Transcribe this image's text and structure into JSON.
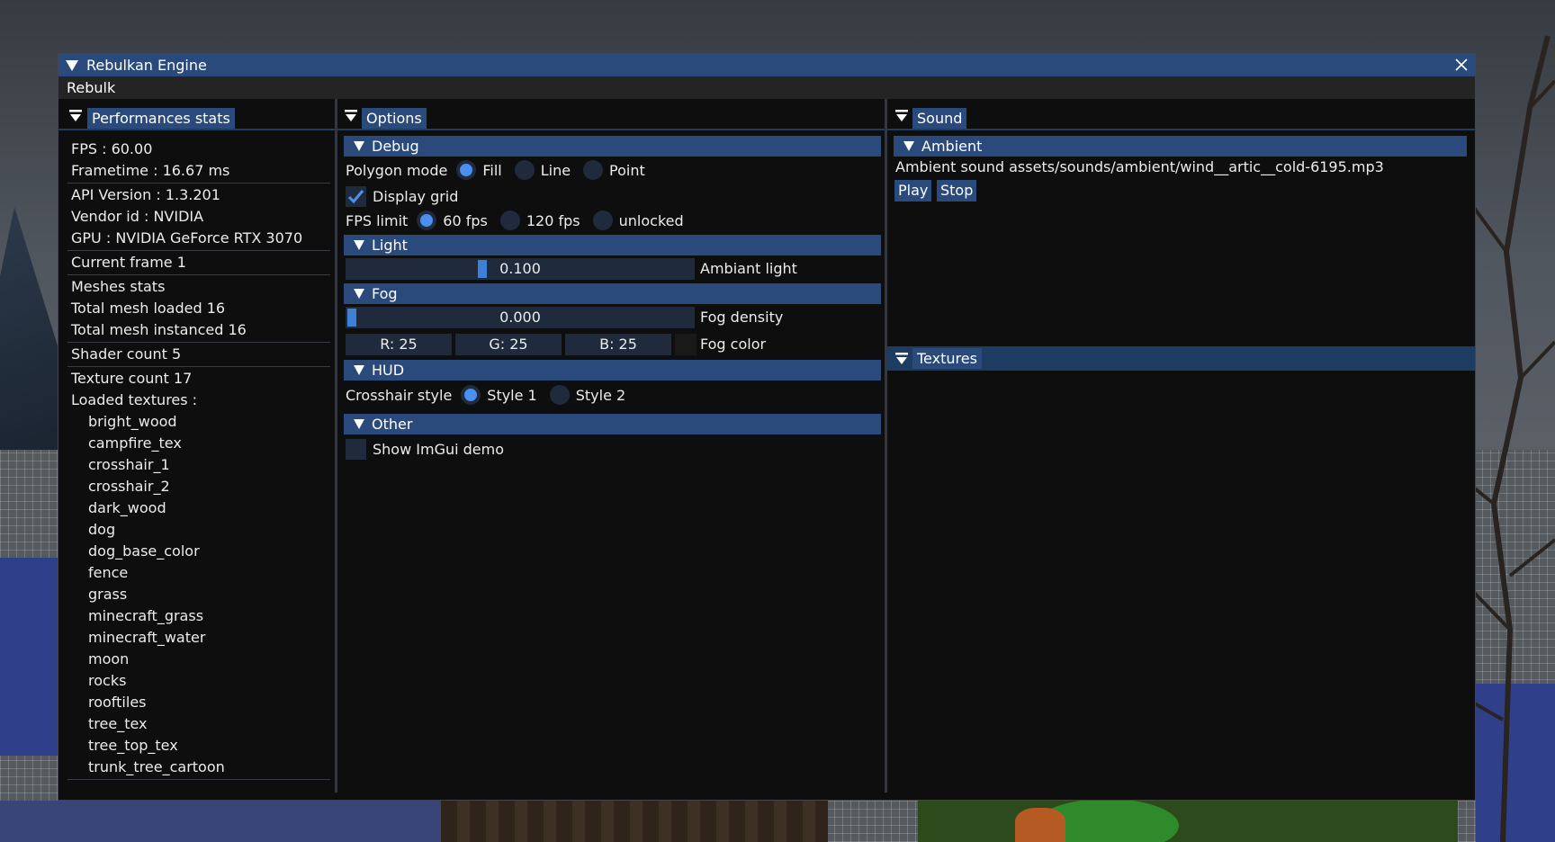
{
  "window": {
    "title": "Rebulkan Engine",
    "menu": [
      "Rebulk"
    ],
    "accent_color": "#294a7a"
  },
  "perf": {
    "tab_label": "Performances stats",
    "groups": [
      [
        "FPS : 60.00",
        "Frametime : 16.67 ms"
      ],
      [
        "API Version : 1.3.201",
        "Vendor id : NVIDIA",
        "GPU : NVIDIA GeForce RTX 3070"
      ],
      [
        "Current frame 1"
      ],
      [
        "Meshes stats",
        "Total mesh loaded 16",
        "Total mesh instanced 16"
      ],
      [
        "Shader count 5"
      ],
      [
        "Texture count 17",
        "Loaded textures :"
      ]
    ],
    "textures": [
      "bright_wood",
      "campfire_tex",
      "crosshair_1",
      "crosshair_2",
      "dark_wood",
      "dog",
      "dog_base_color",
      "fence",
      "grass",
      "minecraft_grass",
      "minecraft_water",
      "moon",
      "rocks",
      "rooftiles",
      "tree_tex",
      "tree_top_tex",
      "trunk_tree_cartoon"
    ]
  },
  "options": {
    "tab_label": "Options",
    "debug": {
      "header": "Debug",
      "polygon_label": "Polygon mode",
      "polygon_options": [
        "Fill",
        "Line",
        "Point"
      ],
      "polygon_selected": "Fill",
      "display_grid_label": "Display grid",
      "display_grid_checked": true,
      "fps_label": "FPS limit",
      "fps_options": [
        "60 fps",
        "120 fps",
        "unlocked"
      ],
      "fps_selected": "60 fps"
    },
    "light": {
      "header": "Light",
      "ambient_value": "0.100",
      "ambient_fraction": 0.1,
      "ambient_label": "Ambiant light"
    },
    "fog": {
      "header": "Fog",
      "density_value": "0.000",
      "density_fraction": 0.0,
      "density_label": "Fog density",
      "r": "R: 25",
      "g": "G: 25",
      "b": "B: 25",
      "color_label": "Fog color",
      "swatch_color": "#191919"
    },
    "hud": {
      "header": "HUD",
      "crosshair_label": "Crosshair style",
      "styles": [
        "Style 1",
        "Style 2"
      ],
      "selected": "Style 1"
    },
    "other": {
      "header": "Other",
      "demo_label": "Show ImGui demo",
      "demo_checked": false
    }
  },
  "sound": {
    "tab_label": "Sound",
    "ambient_header": "Ambient",
    "ambient_text": "Ambient sound assets/sounds/ambient/wind__artic__cold-6195.mp3",
    "play_label": "Play",
    "stop_label": "Stop",
    "textures_tab_label": "Textures"
  }
}
